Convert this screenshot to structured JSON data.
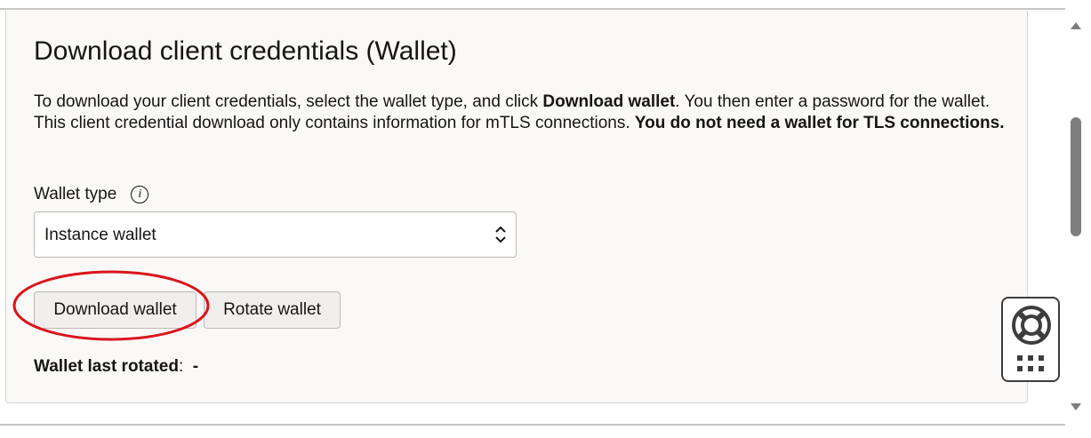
{
  "section": {
    "title": "Download client credentials (Wallet)",
    "description": {
      "part1": "To download your client credentials, select the wallet type, and click ",
      "bold1": "Download wallet",
      "part2": ". You then enter a password for the wallet. This client credential download only contains information for mTLS connections. ",
      "bold2": "You do not need a wallet for TLS connections."
    }
  },
  "wallet_type": {
    "label": "Wallet type",
    "info_icon": "info-icon",
    "selected": "Instance wallet"
  },
  "buttons": {
    "download": "Download wallet",
    "rotate": "Rotate wallet"
  },
  "last_rotated": {
    "label": "Wallet last rotated",
    "value": "-"
  },
  "icons": {
    "help": "lifebuoy-icon",
    "apps": "grid-icon",
    "select": "chevron-up-down-icon"
  },
  "colors": {
    "annotation": "#d9141c",
    "panel_bg": "#fbf9f8",
    "button_bg": "#f1efed"
  }
}
